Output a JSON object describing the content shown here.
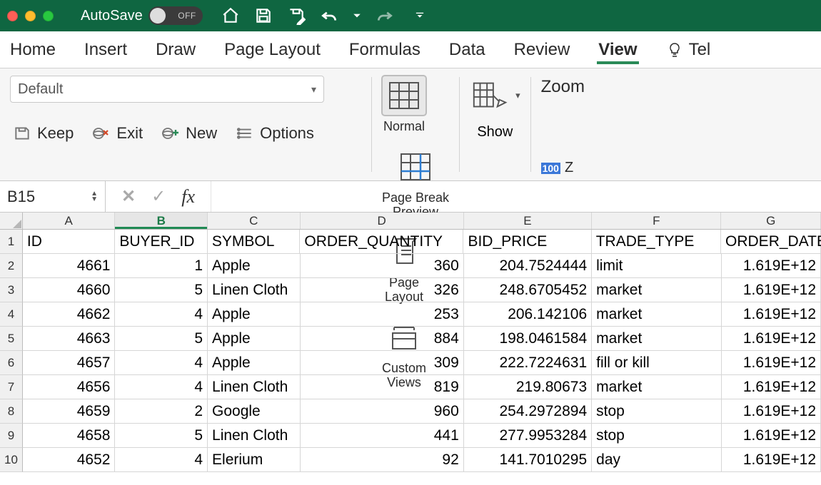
{
  "titlebar": {
    "autosave_label": "AutoSave",
    "autosave_state": "OFF"
  },
  "tabs": {
    "home": "Home",
    "insert": "Insert",
    "draw": "Draw",
    "page_layout": "Page Layout",
    "formulas": "Formulas",
    "data": "Data",
    "review": "Review",
    "view": "View",
    "tell": "Tel"
  },
  "ribbon": {
    "default_dropdown": "Default",
    "keep": "Keep",
    "exit": "Exit",
    "new": "New",
    "options": "Options",
    "normal": "Normal",
    "page_break_preview": "Page Break\nPreview",
    "page_layout": "Page\nLayout",
    "custom_views": "Custom\nViews",
    "show": "Show",
    "zoom": "Zoom",
    "zoom_100_badge": "100",
    "zoom_100_suffix": "Z"
  },
  "formula_bar": {
    "namebox": "B15",
    "fx": "fx",
    "value": ""
  },
  "columns": [
    "A",
    "B",
    "C",
    "D",
    "E",
    "F",
    "G"
  ],
  "selected_column": "B",
  "headers": {
    "A": "ID",
    "B": "BUYER_ID",
    "C": "SYMBOL",
    "D": "ORDER_QUANTITY",
    "E": "BID_PRICE",
    "F": "TRADE_TYPE",
    "G": "ORDER_DATE"
  },
  "rows": [
    {
      "n": 2,
      "A": "4661",
      "B": "1",
      "C": "Apple",
      "D": "360",
      "E": "204.7524444",
      "F": "limit",
      "G": "1.619E+12"
    },
    {
      "n": 3,
      "A": "4660",
      "B": "5",
      "C": "Linen Cloth",
      "D": "326",
      "E": "248.6705452",
      "F": "market",
      "G": "1.619E+12"
    },
    {
      "n": 4,
      "A": "4662",
      "B": "4",
      "C": "Apple",
      "D": "253",
      "E": "206.142106",
      "F": "market",
      "G": "1.619E+12"
    },
    {
      "n": 5,
      "A": "4663",
      "B": "5",
      "C": "Apple",
      "D": "884",
      "E": "198.0461584",
      "F": "market",
      "G": "1.619E+12"
    },
    {
      "n": 6,
      "A": "4657",
      "B": "4",
      "C": "Apple",
      "D": "309",
      "E": "222.7224631",
      "F": "fill or kill",
      "G": "1.619E+12"
    },
    {
      "n": 7,
      "A": "4656",
      "B": "4",
      "C": "Linen Cloth",
      "D": "819",
      "E": "219.80673",
      "F": "market",
      "G": "1.619E+12"
    },
    {
      "n": 8,
      "A": "4659",
      "B": "2",
      "C": "Google",
      "D": "960",
      "E": "254.2972894",
      "F": "stop",
      "G": "1.619E+12"
    },
    {
      "n": 9,
      "A": "4658",
      "B": "5",
      "C": "Linen Cloth",
      "D": "441",
      "E": "277.9953284",
      "F": "stop",
      "G": "1.619E+12"
    },
    {
      "n": 10,
      "A": "4652",
      "B": "4",
      "C": "Elerium",
      "D": "92",
      "E": "141.7010295",
      "F": "day",
      "G": "1.619E+12"
    }
  ]
}
